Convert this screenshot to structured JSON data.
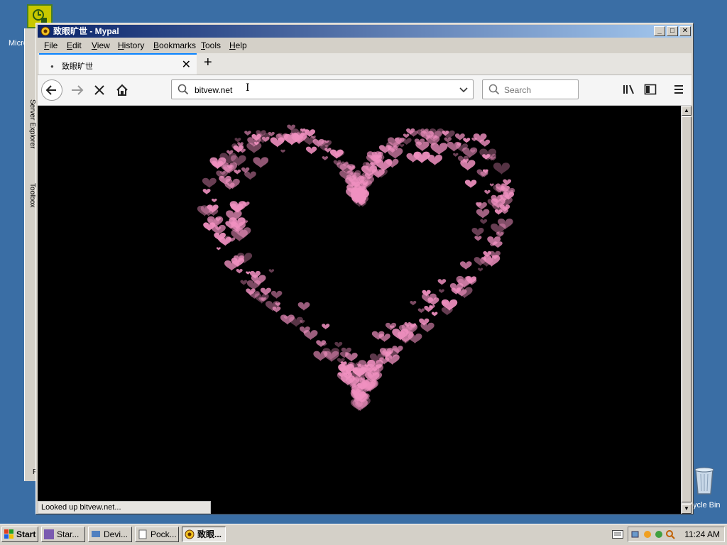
{
  "desktop": {
    "left_label": "Micro",
    "recycle_label": "ycle Bin",
    "bg_app": {
      "tab1": "Server Explorer",
      "tab2": "Toolbox",
      "bottom_label": "F"
    }
  },
  "window": {
    "title": "致眼旷世 - Mypal",
    "menu": [
      "File",
      "Edit",
      "View",
      "History",
      "Bookmarks",
      "Tools",
      "Help"
    ],
    "tab": {
      "title": "致眼旷世",
      "close": "✕"
    },
    "new_tab": "+",
    "url": "bitvew.net",
    "search_placeholder": "Search",
    "status": "Looked up bitvew.net...",
    "controls": {
      "minimize": "_",
      "maximize": "□",
      "close": "✕"
    }
  },
  "content": {
    "background": "#000000",
    "heart_color": "#f090c0",
    "image_description": "heart made of small pink hearts"
  },
  "taskbar": {
    "start": "Start",
    "tasks": [
      "Star...",
      "Devi...",
      "Pock...",
      "致眼..."
    ],
    "active_task_index": 3,
    "clock": "11:24 AM"
  }
}
